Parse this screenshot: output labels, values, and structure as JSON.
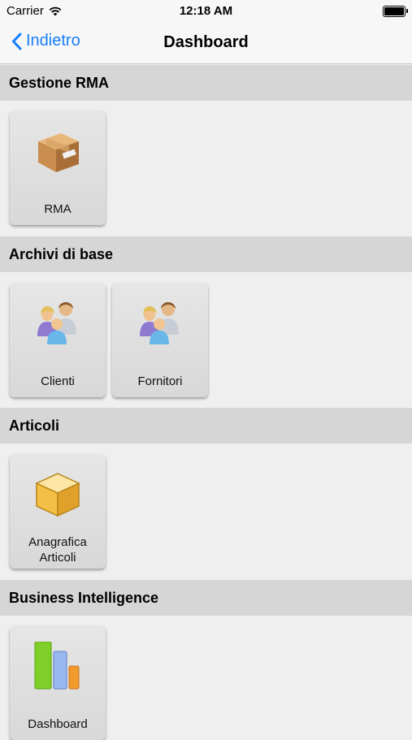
{
  "status_bar": {
    "carrier": "Carrier",
    "time": "12:18 AM"
  },
  "nav": {
    "back_label": "Indietro",
    "title": "Dashboard"
  },
  "sections": [
    {
      "title": "Gestione RMA",
      "tiles": [
        {
          "label": "RMA",
          "icon": "package-icon"
        }
      ]
    },
    {
      "title": "Archivi di base",
      "tiles": [
        {
          "label": "Clienti",
          "icon": "users-icon"
        },
        {
          "label": "Fornitori",
          "icon": "users-icon"
        }
      ]
    },
    {
      "title": "Articoli",
      "tiles": [
        {
          "label": "Anagrafica Articoli",
          "icon": "box-icon"
        }
      ]
    },
    {
      "title": "Business Intelligence",
      "tiles": [
        {
          "label": "Dashboard",
          "icon": "bar-chart-icon"
        }
      ]
    }
  ],
  "colors": {
    "accent": "#157efb",
    "header_bg": "#d6d6d6",
    "background": "#efefef"
  }
}
